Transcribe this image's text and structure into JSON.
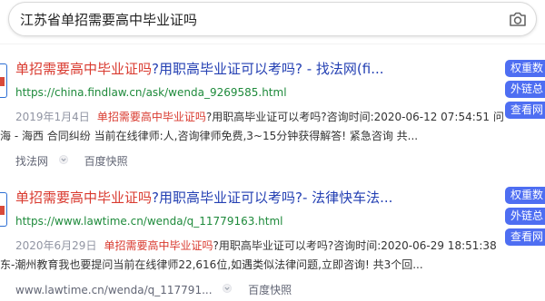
{
  "search": {
    "query": "江苏省单招需要高中毕业证吗"
  },
  "results": [
    {
      "title_hl": "单招需要高中毕业证吗",
      "title_rest": "?用职高毕业证可以考吗? - 找法网(fi...",
      "url": "https://china.findlaw.cn/ask/wenda_9269585.html",
      "date": "2019年1月4日",
      "abstract_hl": "单招需要高中毕业证吗",
      "abstract_rest": "?用职高毕业证可以考吗?咨询时间:2020-06-12 07:54:51 问",
      "abstract_line2": "海 - 海西 合同纠纷 当前在线律师:人,咨询律师免费,3~15分钟获得解答! 紧急咨询 共...",
      "source": "找法网",
      "snapshot": "百度快照"
    },
    {
      "title_hl": "单招需要高中毕业证吗",
      "title_rest": "?用职高毕业证可以考吗?- 法律快车法...",
      "url": "https://www.lawtime.cn/wenda/q_11779163.html",
      "date": "2020年6月29日",
      "abstract_hl": "单招需要高中毕业证吗",
      "abstract_rest": "?用职高毕业证可以考吗?咨询时间:2020-06-29 18:51:38",
      "abstract_line2": "东-潮州教育我也要提问当前在线律师22,616位,如遇类似法律问题,立即咨询! 共3个回...",
      "source": "www.lawtime.cn/wenda/q_117791...",
      "snapshot": "百度快照"
    }
  ],
  "side_buttons": {
    "r1": [
      "权重数",
      "外链总",
      "查看网"
    ],
    "r2": [
      "权重数",
      "外链总",
      "查看网"
    ]
  },
  "colors": {
    "link": "#2440b3",
    "highlight": "#d93a2f",
    "url": "#1e8a3b",
    "side_button": "#4e6ef2"
  }
}
